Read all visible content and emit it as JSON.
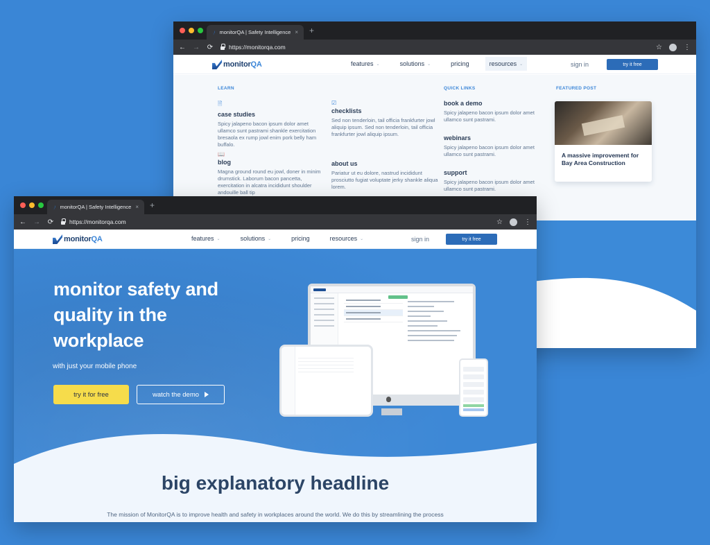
{
  "browser": {
    "tab_title": "monitorQA | Safety Intelligence",
    "tab_close": "×",
    "new_tab": "+",
    "url": "https://monitorqa.com",
    "back_icon": "arrow-left-icon",
    "forward_icon": "arrow-right-icon",
    "reload_icon": "reload-icon",
    "star_icon": "star-icon",
    "menu_icon": "kebab-icon"
  },
  "site": {
    "logo_pre": "monitor",
    "logo_post": "QA",
    "nav": [
      "features",
      "solutions",
      "pricing",
      "resources"
    ],
    "sign_in": "sign in",
    "try_free": "try it free"
  },
  "mega_menu": {
    "learn_heading": "LEARN",
    "quick_links_heading": "QUICK LINKS",
    "featured_heading": "FEATURED POST",
    "learn": [
      {
        "title": "case studies",
        "desc": "Spicy jalapeno bacon ipsum dolor amet ullamco sunt pastrami shankle exercitation bresaola ex rump jowl enim pork belly ham buffalo.",
        "icon": "document-icon"
      },
      {
        "title": "checklists",
        "desc": "Sed non tenderloin, tail officia frankfurter jowl aliquip ipsum. Sed non tenderloin, tail officia frankfurter jowl aliquip ipsum.",
        "icon": "checklist-icon"
      },
      {
        "title": "blog",
        "desc": "Magna ground round eu jowl, doner in minim drumstick. Laborum bacon pancetta, exercitation in alcatra incididunt shoulder andouille ball tip",
        "icon": "book-icon"
      },
      {
        "title": "about us",
        "desc": "Pariatur ut eu dolore, nastrud incididunt prosciutto fugiat voluptate jerky shankle aliqua lorem.",
        "icon": ""
      }
    ],
    "quick_links": [
      {
        "title": "book a demo",
        "desc": "Spicy jalapeno bacon ipsum dolor amet ullamco sunt pastrami."
      },
      {
        "title": "webinars",
        "desc": "Spicy jalapeno bacon ipsum dolor amet ullamco sunt pastrami."
      },
      {
        "title": "support",
        "desc": "Spicy jalapeno bacon ipsum dolor amet ullamco sunt pastrami."
      }
    ],
    "featured_title": "A massive improvement for Bay Area Construction"
  },
  "hero": {
    "headline": "monitor safety and quality in the workplace",
    "subline": "with just your mobile phone",
    "cta_primary": "try it for free",
    "cta_secondary": "watch the demo"
  },
  "section": {
    "headline": "big explanatory headline",
    "paragraph": "The mission of MonitorQA is to improve health and safety in workplaces around the world. We do this by streamlining the process"
  },
  "colors": {
    "brand_blue": "#3c86d8",
    "button_blue": "#2c6cb8",
    "cta_yellow": "#f6dc4b",
    "heading_navy": "#2c4566"
  }
}
